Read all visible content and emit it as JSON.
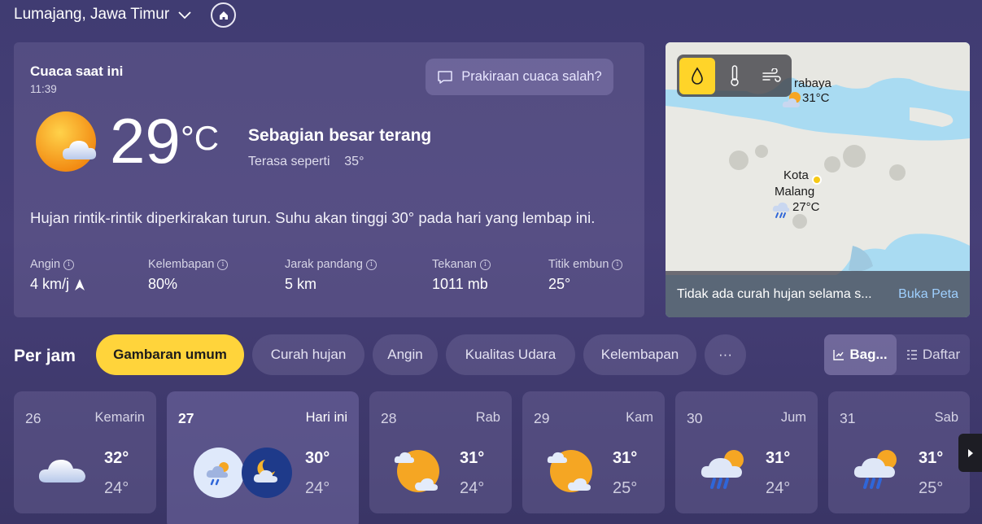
{
  "header": {
    "location": "Lumajang, Jawa Timur"
  },
  "current": {
    "title": "Cuaca saat ini",
    "time": "11:39",
    "feedback_label": "Prakiraan cuaca salah?",
    "icon": "sun-behind-cloud-icon",
    "temperature": "29",
    "unit": "°C",
    "condition": "Sebagian besar terang",
    "feels_like_label": "Terasa seperti",
    "feels_like_value": "35°",
    "summary": "Hujan rintik-rintik diperkirakan turun. Suhu akan tinggi 30° pada hari yang lembap ini.",
    "stats": [
      {
        "label": "Angin",
        "value": "4 km/j"
      },
      {
        "label": "Kelembapan",
        "value": "80%"
      },
      {
        "label": "Jarak pandang",
        "value": "5 km"
      },
      {
        "label": "Tekanan",
        "value": "1011 mb"
      },
      {
        "label": "Titik embun",
        "value": "25°"
      }
    ]
  },
  "map": {
    "city1_name": "rabaya",
    "city1_temp": "31°C",
    "city2_name_line1": "Kota",
    "city2_name_line2": "Malang",
    "city2_temp": "27°C",
    "footer_text": "Tidak ada curah hujan selama s...",
    "footer_link": "Buka Peta",
    "tools": [
      "precipitation-icon",
      "temperature-icon",
      "wind-icon"
    ],
    "active_tool": "precipitation-icon"
  },
  "hourly": {
    "title": "Per jam",
    "chips": [
      "Gambaran umum",
      "Curah hujan",
      "Angin",
      "Kualitas Udara",
      "Kelembapan",
      "···"
    ],
    "active_chip": "Gambaran umum",
    "view_chart": "Bag...",
    "view_list": "Daftar"
  },
  "days": [
    {
      "num": "26",
      "name": "Kemarin",
      "hi": "32°",
      "lo": "24°",
      "icon": "cloud-icon"
    },
    {
      "num": "27",
      "name": "Hari ini",
      "hi": "30°",
      "lo": "24°",
      "icon": "rain-showers-icon"
    },
    {
      "num": "28",
      "name": "Rab",
      "hi": "31°",
      "lo": "24°",
      "icon": "partly-sunny-icon"
    },
    {
      "num": "29",
      "name": "Kam",
      "hi": "31°",
      "lo": "25°",
      "icon": "partly-sunny-icon"
    },
    {
      "num": "30",
      "name": "Jum",
      "hi": "31°",
      "lo": "24°",
      "icon": "rain-showers-icon"
    },
    {
      "num": "31",
      "name": "Sab",
      "hi": "31°",
      "lo": "25°",
      "icon": "rain-showers-icon"
    }
  ],
  "colors": {
    "accent": "#ffd43b",
    "background": "#403c72"
  }
}
